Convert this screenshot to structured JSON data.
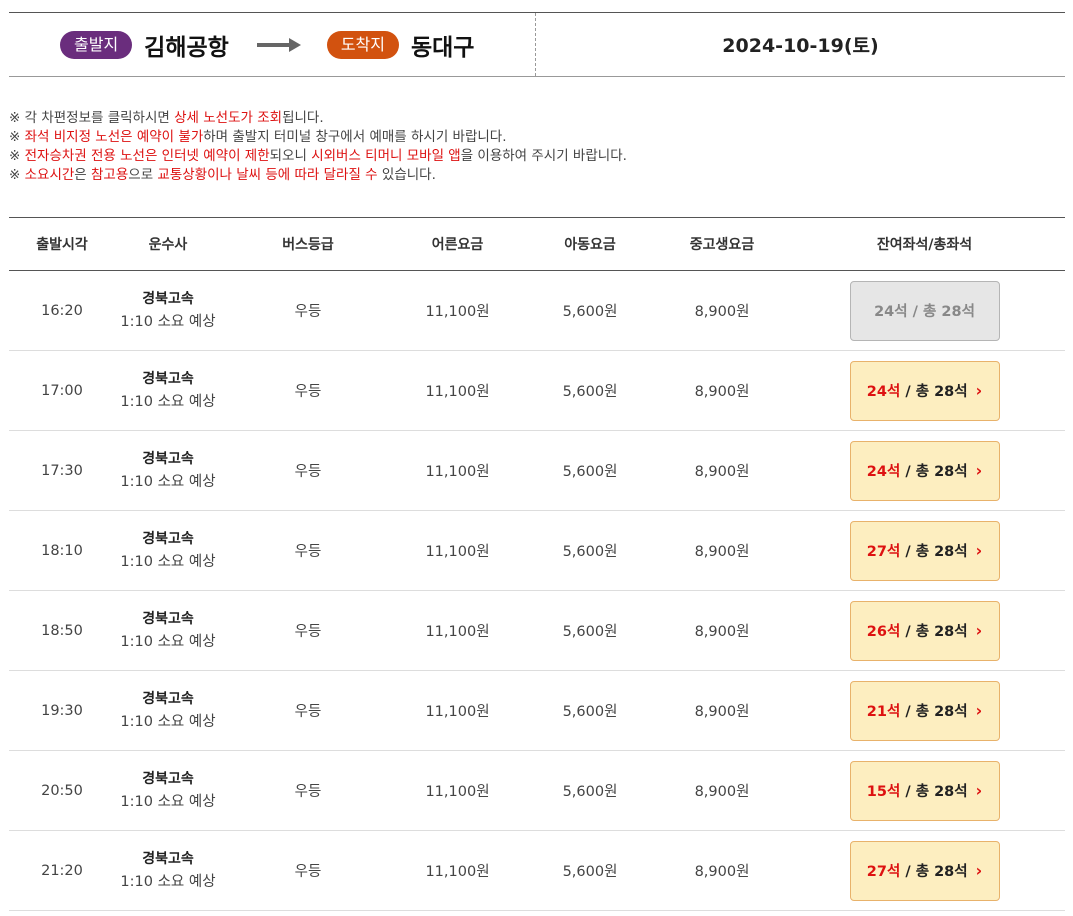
{
  "route": {
    "departure_label": "출발지",
    "departure": "김해공항",
    "arrival_label": "도착지",
    "arrival": "동대구",
    "date": "2024-10-19(토)"
  },
  "notices": [
    [
      {
        "t": "※ 각 차편정보를 클릭하시면 "
      },
      {
        "t": "상세 노선도가 조회",
        "red": true
      },
      {
        "t": "됩니다."
      }
    ],
    [
      {
        "t": "※ "
      },
      {
        "t": "좌석 비지정 노선은 예약이 불가",
        "red": true
      },
      {
        "t": "하며 출발지 터미널 창구에서 예매를 하시기 바랍니다."
      }
    ],
    [
      {
        "t": "※ "
      },
      {
        "t": "전자승차권 전용 노선은 인터넷 예약이 제한",
        "red": true
      },
      {
        "t": "되오니 "
      },
      {
        "t": "시외버스 티머니 모바일 앱",
        "red": true
      },
      {
        "t": "을 이용하여 주시기 바랍니다."
      }
    ],
    [
      {
        "t": "※ "
      },
      {
        "t": "소요시간",
        "red": true
      },
      {
        "t": "은 "
      },
      {
        "t": "참고용",
        "red": true
      },
      {
        "t": "으로 "
      },
      {
        "t": "교통상황이나 날씨 등에 따라 달라질 수",
        "red": true
      },
      {
        "t": " 있습니다."
      }
    ]
  ],
  "columns": [
    "출발시각",
    "운수사",
    "버스등급",
    "어른요금",
    "아동요금",
    "중고생요금",
    "잔여좌석/총좌석"
  ],
  "seat_suffix": "석",
  "seat_sep": " / 총 ",
  "rows": [
    {
      "time": "16:20",
      "company": "경북고속",
      "duration": "1:10 소요 예상",
      "grade": "우등",
      "adult": "11,100원",
      "child": "5,600원",
      "youth": "8,900원",
      "remaining": "24석",
      "total": "28석",
      "available": false
    },
    {
      "time": "17:00",
      "company": "경북고속",
      "duration": "1:10 소요 예상",
      "grade": "우등",
      "adult": "11,100원",
      "child": "5,600원",
      "youth": "8,900원",
      "remaining": "24석",
      "total": "28석",
      "available": true
    },
    {
      "time": "17:30",
      "company": "경북고속",
      "duration": "1:10 소요 예상",
      "grade": "우등",
      "adult": "11,100원",
      "child": "5,600원",
      "youth": "8,900원",
      "remaining": "24석",
      "total": "28석",
      "available": true
    },
    {
      "time": "18:10",
      "company": "경북고속",
      "duration": "1:10 소요 예상",
      "grade": "우등",
      "adult": "11,100원",
      "child": "5,600원",
      "youth": "8,900원",
      "remaining": "27석",
      "total": "28석",
      "available": true
    },
    {
      "time": "18:50",
      "company": "경북고속",
      "duration": "1:10 소요 예상",
      "grade": "우등",
      "adult": "11,100원",
      "child": "5,600원",
      "youth": "8,900원",
      "remaining": "26석",
      "total": "28석",
      "available": true
    },
    {
      "time": "19:30",
      "company": "경북고속",
      "duration": "1:10 소요 예상",
      "grade": "우등",
      "adult": "11,100원",
      "child": "5,600원",
      "youth": "8,900원",
      "remaining": "21석",
      "total": "28석",
      "available": true
    },
    {
      "time": "20:50",
      "company": "경북고속",
      "duration": "1:10 소요 예상",
      "grade": "우등",
      "adult": "11,100원",
      "child": "5,600원",
      "youth": "8,900원",
      "remaining": "15석",
      "total": "28석",
      "available": true
    },
    {
      "time": "21:20",
      "company": "경북고속",
      "duration": "1:10 소요 예상",
      "grade": "우등",
      "adult": "11,100원",
      "child": "5,600원",
      "youth": "8,900원",
      "remaining": "27석",
      "total": "28석",
      "available": true
    }
  ],
  "colors": {
    "departure": "#6a2d7d",
    "arrival": "#d2520f",
    "highlight": "#dd1111",
    "seat_bg": "#fdeec0"
  },
  "icons": {
    "route_arrow": "arrow-right-icon",
    "seat_chevron": "chevron-right-icon"
  }
}
